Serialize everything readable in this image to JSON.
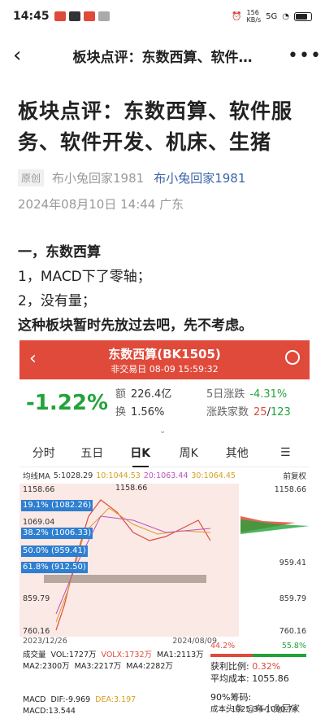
{
  "status": {
    "time": "14:45",
    "net_speed": "156\nKB/s",
    "signal": "5G",
    "battery": "100"
  },
  "nav": {
    "title": "板块点评：东数西算、软件…",
    "more_icon": "ellipsis-icon"
  },
  "article": {
    "headline": "板块点评：东数西算、软件服务、软件开发、机床、生猪",
    "tag": "原创",
    "author_grey": "布小兔回家1981",
    "author_link": "布小兔回家1981",
    "dateline": "2024年08月10日 14:44  广东",
    "section_title": "一，东数西算",
    "line1": "1，MACD下了零轴；",
    "line2": "2，没有量；",
    "line3": "这种板块暂时先放过去吧，先不考虑。"
  },
  "stock": {
    "name": "东数西算(BK1505)",
    "sub": "非交易日  08-09 15:59:32",
    "change_pct": "-1.22%",
    "amount_label": "额",
    "amount": "226.4亿",
    "d5_label": "5日涨跌",
    "d5": "-4.31%",
    "turnover_label": "换",
    "turnover": "1.56%",
    "updown_label": "涨跌家数",
    "up": "25",
    "sep": "/",
    "down": "123",
    "tabs": [
      "分时",
      "五日",
      "日K",
      "周K",
      "其他"
    ],
    "ma_title": "均线MA",
    "ma5": "5:1028.29",
    "ma10": "10:1044.53",
    "ma20": "20:1063.44",
    "ma30": "30:1064.45",
    "adjust": "前复权",
    "fib_levels": [
      "19.1% (1082.26)",
      "38.2% (1006.33)",
      "50.0% (959.41)",
      "61.8% (912.50)"
    ],
    "left_labels": [
      "1158.66",
      "1069.04",
      "859.79",
      "760.16"
    ],
    "peak_label": "1158.66",
    "right_labels": [
      "1158.66",
      "959.41",
      "859.79",
      "760.16"
    ],
    "date_start": "2023/12/26",
    "date_end": "2024/08/09",
    "vol_line": "成交量",
    "vol": "VOL:1727万",
    "volx": "VOLX:1732万",
    "ma1": "MA1:2113万",
    "ma2": "MA2:2300万",
    "ma3": "MA3:2217万",
    "ma4": "MA4:2282万",
    "macd_line": "MACD",
    "dif": "DIF:-9.969",
    "dea": "DEA:3.197",
    "macd": "MACD:13.544",
    "stat_left": "44.2%",
    "stat_right": "55.8%",
    "profit_label": "获利比例:",
    "profit": "0.32%",
    "avgcost_label": "平均成本:",
    "avgcost": "1055.86",
    "chip_label": "90%筹码:",
    "chip_cost": "成本: 1025.34-1090.74",
    "watermark": "头条 @布小兔回家",
    "colors": {
      "up": "#e04a3a",
      "down": "#22a33a",
      "header": "#e04a3a",
      "fib": "#2f7fd0"
    }
  }
}
